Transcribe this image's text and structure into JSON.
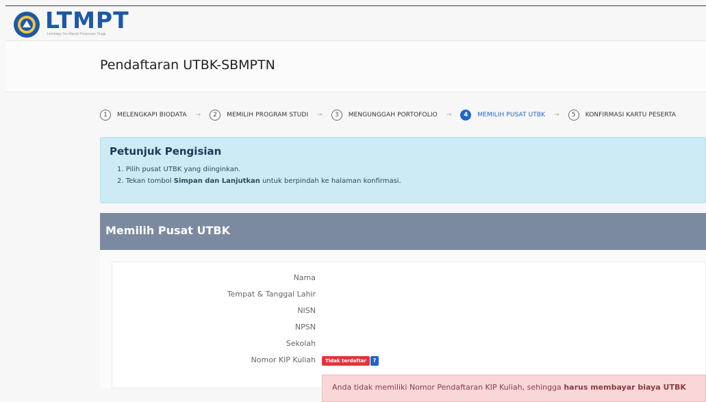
{
  "header": {
    "logo_title": "LTMPT",
    "logo_subtitle": "Lembaga Tes Masuk Perguruan Tinggi"
  },
  "page": {
    "title": "Pendaftaran UTBK-SBMPTN"
  },
  "steps": [
    {
      "number": "1",
      "label": "MELENGKAPI BIODATA"
    },
    {
      "number": "2",
      "label": "MEMILIH PROGRAM STUDI"
    },
    {
      "number": "3",
      "label": "MENGUNGGAH PORTOFOLIO"
    },
    {
      "number": "4",
      "label": "MEMILIH PUSAT UTBK"
    },
    {
      "number": "5",
      "label": "KONFIRMASI KARTU PESERTA"
    }
  ],
  "active_step": "4",
  "instructions": {
    "title": "Petunjuk Pengisian",
    "item1": "1. Pilih pusat UTBK yang diinginkan.",
    "item2_prefix": "2. Tekan tombol ",
    "item2_bold": "Simpan dan Lanjutkan",
    "item2_suffix": " untuk berpindah ke halaman konfirmasi."
  },
  "panel": {
    "title": "Memilih Pusat UTBK"
  },
  "form": {
    "nama_label": "Nama",
    "ttl_label": "Tempat & Tanggal Lahir",
    "nisn_label": "NISN",
    "npsn_label": "NPSN",
    "sekolah_label": "Sekolah",
    "kip_label": "Nomor KIP Kuliah",
    "kip_status": "Tidak terdaftar",
    "help_label": "?"
  },
  "alert": {
    "text_prefix": "Anda tidak memiliki Nomor Pendaftaran KIP Kuliah, sehingga ",
    "text_bold": "harus membayar biaya UTBK"
  },
  "colors": {
    "brand": "#1d59a5",
    "active": "#1f64c8",
    "panel_header": "#7c8aa1",
    "danger": "#e0363c"
  }
}
